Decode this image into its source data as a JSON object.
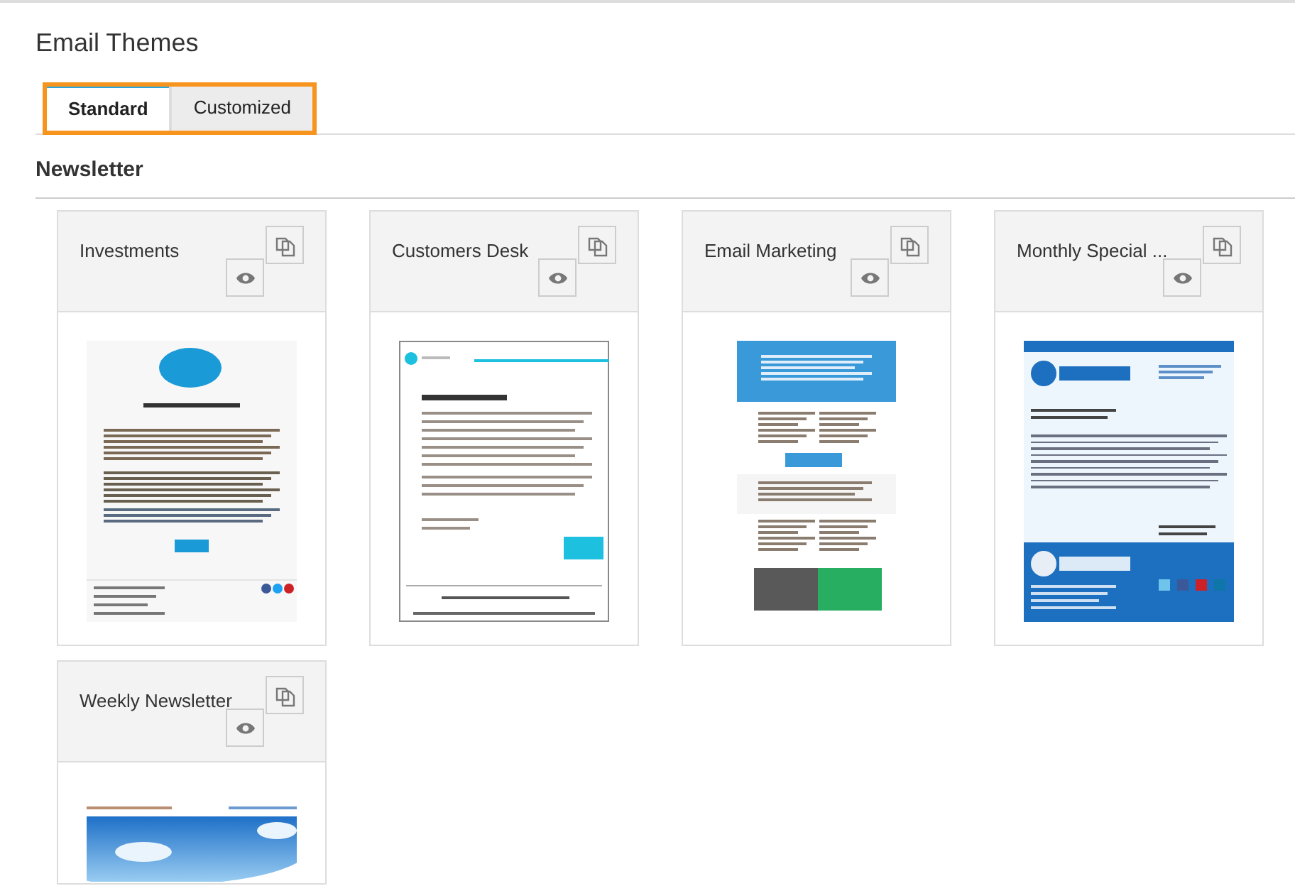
{
  "page": {
    "title": "Email Themes"
  },
  "tabs": [
    {
      "label": "Standard",
      "selected": true
    },
    {
      "label": "Customized",
      "selected": false
    }
  ],
  "section": {
    "title": "Newsletter"
  },
  "themes": [
    {
      "name": "Investments",
      "kind": "logo"
    },
    {
      "name": "Customers Desk",
      "kind": "letter"
    },
    {
      "name": "Email Marketing",
      "kind": "marketing"
    },
    {
      "name": "Monthly Special ...",
      "kind": "corporate"
    },
    {
      "name": "Weekly Newsletter",
      "kind": "sky"
    }
  ]
}
